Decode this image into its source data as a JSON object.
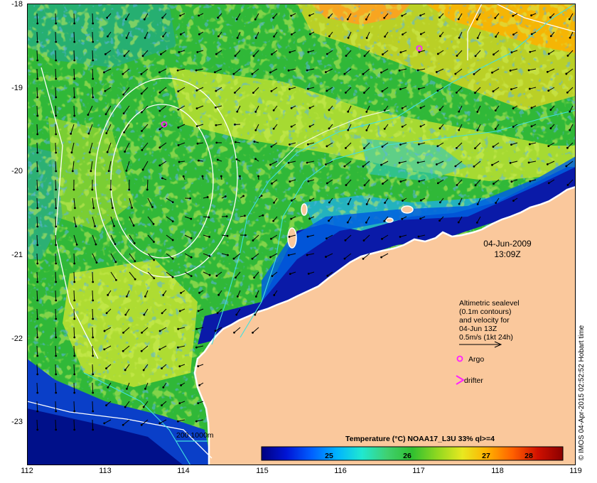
{
  "map": {
    "date": "04-Jun-2009",
    "time": "13:09Z",
    "legend": {
      "line1": "Altimetric sealevel",
      "line2": "(0.1m contours)",
      "line3": "and velocity for",
      "line4": "04-Jun 13Z",
      "line5": "0.5m/s (1kt 24h)",
      "argo": "Argo",
      "drifter": "drifter"
    },
    "depth_label": "200  1000m",
    "colorbar": {
      "title": "Temperature (°C) NOAA17_L3U 33% ql>=4",
      "ticks": [
        "25",
        "26",
        "27",
        "28"
      ],
      "colors": [
        "#00007f",
        "#0015d6",
        "#0060ff",
        "#00b4ff",
        "#20e8d0",
        "#40d070",
        "#30c030",
        "#90d820",
        "#e8e820",
        "#ffb000",
        "#ff6000",
        "#d01000",
        "#8a0000"
      ]
    },
    "credit": "© IMOS 04-Apr-2015 02:52:52 Hobart time",
    "lat_ticks": [
      "-18",
      "-19",
      "-20",
      "-21",
      "-22",
      "-23"
    ],
    "lon_ticks": [
      "112",
      "113",
      "114",
      "115",
      "116",
      "117",
      "118",
      "119"
    ],
    "colors": {
      "land": "#fac89c",
      "ocean_green": "#30b838",
      "coast_blue": "#0a1aa8"
    }
  }
}
